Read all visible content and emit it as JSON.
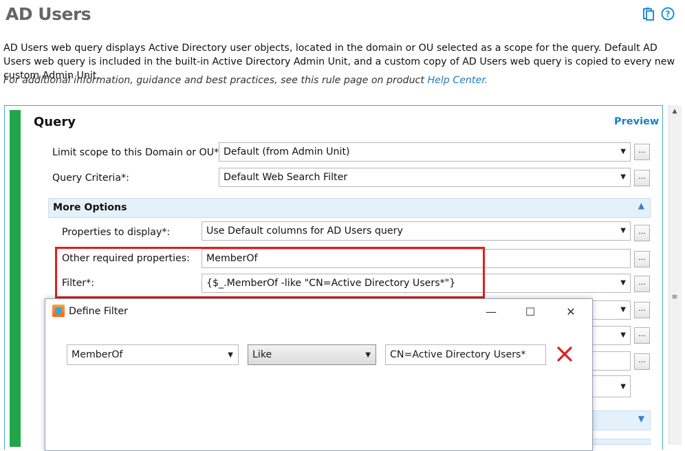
{
  "header": {
    "title": "AD Users",
    "icons": [
      "clipboard-icon",
      "help-icon"
    ]
  },
  "description": "AD Users web query displays Active Directory user objects, located in the domain or OU selected as a scope for the query. Default AD Users web query is included in the built-in Active Directory Admin Unit, and a custom copy of AD Users web query is copied to every new custom Admin Unit.",
  "hint": {
    "text": "For additional information, guidance and best practices, see this rule page on product ",
    "link": "Help Center."
  },
  "query": {
    "title": "Query",
    "preview_label": "Preview",
    "scope_label": "Limit scope to this Domain or OU*:",
    "scope_value": "Default (from Admin Unit)",
    "criteria_label": "Query Criteria*:",
    "criteria_value": "Default Web Search Filter",
    "browse_label": "..."
  },
  "more_options": {
    "title": "More Options",
    "properties_label": "Properties to display*:",
    "properties_value": "Use Default columns for AD Users query",
    "other_label": "Other required properties:",
    "other_value": "MemberOf",
    "filter_label": "Filter*:",
    "filter_value": "{$_.MemberOf -like \"CN=Active Directory Users*\"}"
  },
  "dialog": {
    "title": "Define Filter",
    "property": "MemberOf",
    "operator": "Like",
    "value": "CN=Active Directory Users*",
    "minimize": "—",
    "maximize": "☐",
    "close": "✕"
  },
  "colors": {
    "accent": "#1f7cc4",
    "green_bar": "#1fa84a",
    "highlight_red": "#e01e1e",
    "section_bg": "#e4f1fb"
  }
}
